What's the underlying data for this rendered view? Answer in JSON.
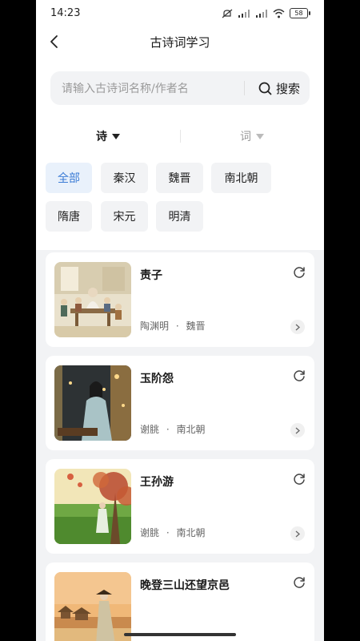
{
  "status": {
    "time": "14:23",
    "battery": "58"
  },
  "nav": {
    "title": "古诗词学习"
  },
  "search": {
    "placeholder": "请输入古诗词名称/作者名",
    "button": "搜索"
  },
  "tabs": [
    {
      "label": "诗"
    },
    {
      "label": "词"
    }
  ],
  "dynasties": [
    "全部",
    "秦汉",
    "魏晋",
    "南北朝",
    "隋唐",
    "宋元",
    "明清"
  ],
  "poems": [
    {
      "title": "责子",
      "author": "陶渊明",
      "dynasty": "魏晋",
      "separator": "·"
    },
    {
      "title": "玉阶怨",
      "author": "谢朓",
      "dynasty": "南北朝",
      "separator": "·"
    },
    {
      "title": "王孙游",
      "author": "谢朓",
      "dynasty": "南北朝",
      "separator": "·"
    },
    {
      "title": "晚登三山还望京邑",
      "author": "",
      "dynasty": "",
      "separator": ""
    }
  ],
  "colors": {
    "accent": "#3a7bd5",
    "chip_active_bg": "#e9f1fb",
    "page_bg": "#f2f3f5"
  }
}
